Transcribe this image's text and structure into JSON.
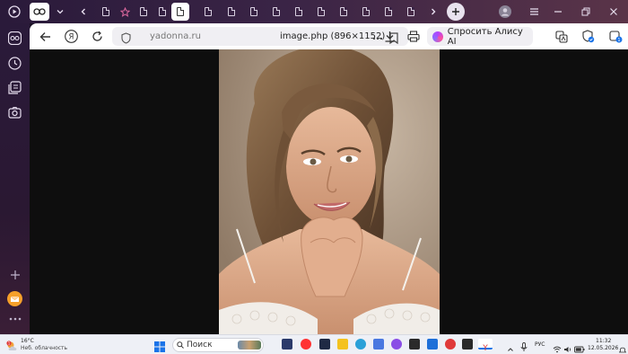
{
  "browser": {
    "address": {
      "domain": "yadonna.ru",
      "page_title": "image.php (896×1152)"
    },
    "alice_button": {
      "label": "Спросить Алису AI"
    },
    "downloads_badge": "1"
  },
  "tabs": {
    "count_visible": 18,
    "active_index": 5
  },
  "content": {
    "image_alt": "Portrait photo of a smiling woman with wavy brown hair, hands clasped under chin"
  },
  "taskbar": {
    "weather": {
      "temp": "16°C",
      "desc": "Неб. облачность",
      "alert_badge": "1"
    },
    "search": {
      "placeholder": "Поиск"
    },
    "lang": "РУС",
    "clock": {
      "time": "11:32",
      "date": "12.05.2026"
    }
  },
  "colors": {
    "tabstrip": "#2a1a3a",
    "accent_alice": "#b044ff",
    "viewport_bg": "#0e0e0e",
    "taskbar_bg": "#eef0f6"
  }
}
